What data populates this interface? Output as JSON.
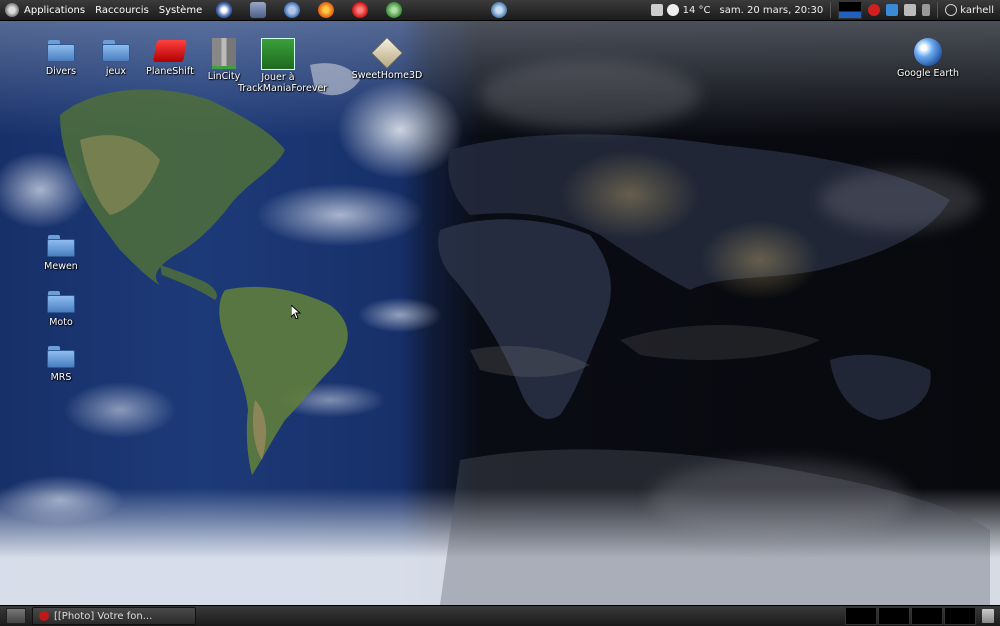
{
  "top_panel": {
    "menus": [
      "Applications",
      "Raccourcis",
      "Système"
    ],
    "weather": "14 °C",
    "clock": "sam. 20 mars, 20:30",
    "user": "karhell"
  },
  "desktop": {
    "icons": [
      {
        "label": "Divers"
      },
      {
        "label": "jeux"
      },
      {
        "label": "PlaneShift"
      },
      {
        "label": "LinCity"
      },
      {
        "label": "Jouer à TrackManiaForever"
      },
      {
        "label": "SweetHome3D"
      },
      {
        "label": "Google Earth"
      },
      {
        "label": "Mewen"
      },
      {
        "label": "Moto"
      },
      {
        "label": "MRS"
      }
    ]
  },
  "bottom_panel": {
    "task_label": "[[Photo] Votre fon..."
  },
  "colors": {
    "panel": "#262626",
    "folder_blue": "#6d9ed8",
    "ocean": "#1d3a78",
    "night": "#08090d"
  }
}
